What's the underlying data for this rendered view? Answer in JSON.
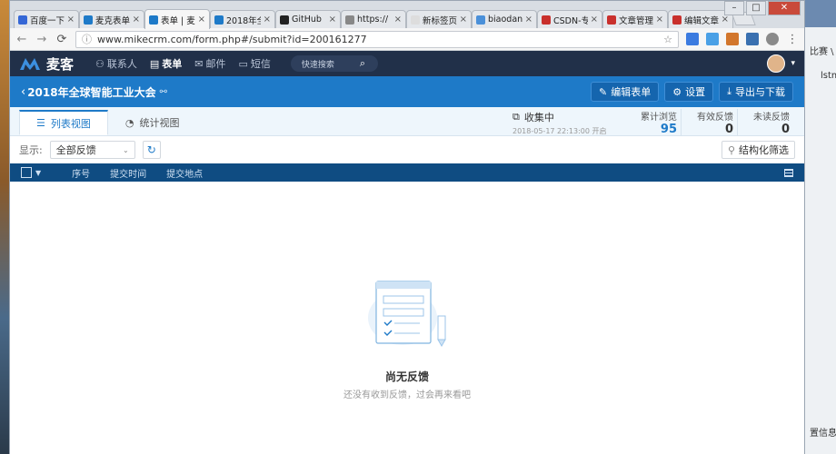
{
  "browser": {
    "tabs": [
      {
        "label": "百度一下",
        "color": "#3567d6"
      },
      {
        "label": "麦克表单",
        "color": "#1e7ac8"
      },
      {
        "label": "表单 | 麦",
        "color": "#1e7ac8",
        "active": true
      },
      {
        "label": "2018年全",
        "color": "#1e7ac8"
      },
      {
        "label": "GitHub",
        "color": "#222222"
      },
      {
        "label": "https://",
        "color": "#888888"
      },
      {
        "label": "新标签页",
        "color": "#dddddd"
      },
      {
        "label": "biaodan",
        "color": "#4a90d9"
      },
      {
        "label": "CSDN-专",
        "color": "#c9302c"
      },
      {
        "label": "文章管理",
        "color": "#c9302c"
      },
      {
        "label": "编辑文章",
        "color": "#c9302c"
      }
    ],
    "url": "www.mikecrm.com/form.php#/submit?id=200161277"
  },
  "app": {
    "brand": "麦客",
    "nav": [
      {
        "label": "联系人",
        "icon": "person-icon"
      },
      {
        "label": "表单",
        "icon": "form-icon",
        "active": true
      },
      {
        "label": "邮件",
        "icon": "mail-icon"
      },
      {
        "label": "短信",
        "icon": "sms-icon"
      }
    ],
    "quick_search": "快速搜索"
  },
  "form": {
    "title": "2018年全球智能工业大会",
    "actions": {
      "edit": "编辑表单",
      "settings": "设置",
      "export": "导出与下载"
    }
  },
  "views": {
    "list": "列表视图",
    "stats": "统计视图",
    "status": "收集中",
    "status_time": "2018-05-17 22:13:00 开启"
  },
  "stats": [
    {
      "label": "累计浏览",
      "value": "95"
    },
    {
      "label": "有效反馈",
      "value": "0"
    },
    {
      "label": "未读反馈",
      "value": "0"
    }
  ],
  "filter": {
    "show_label": "显示:",
    "selected": "全部反馈",
    "structured": "结构化筛选"
  },
  "table": {
    "columns": [
      "序号",
      "提交时间",
      "提交地点"
    ]
  },
  "empty": {
    "title": "尚无反馈",
    "subtitle": "还没有收到反馈，过会再来看吧"
  },
  "desktop": {
    "right_notes": [
      "比赛 \\",
      "lstm",
      "置信息"
    ]
  },
  "colors": {
    "accent": "#1e7ac8",
    "header": "#213049",
    "table_header": "#0f4c82"
  }
}
